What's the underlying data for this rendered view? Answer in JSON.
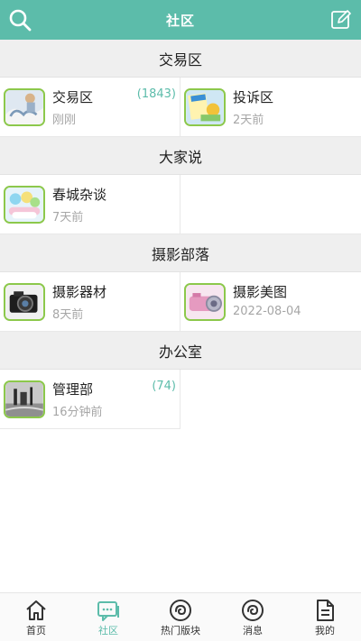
{
  "header": {
    "title": "社区"
  },
  "sections": [
    {
      "title": "交易区",
      "forums": [
        {
          "name": "交易区",
          "count": "(1843)",
          "time": "刚刚"
        },
        {
          "name": "投诉区",
          "count": "",
          "time": "2天前"
        }
      ]
    },
    {
      "title": "大家说",
      "forums": [
        {
          "name": "春城杂谈",
          "count": "",
          "time": "7天前"
        }
      ]
    },
    {
      "title": "摄影部落",
      "forums": [
        {
          "name": "摄影器材",
          "count": "",
          "time": "8天前"
        },
        {
          "name": "摄影美图",
          "count": "",
          "time": "2022-08-04"
        }
      ]
    },
    {
      "title": "办公室",
      "forums": [
        {
          "name": "管理部",
          "count": "(74)",
          "time": "16分钟前"
        }
      ]
    }
  ],
  "tabbar": [
    {
      "label": "首页",
      "icon": "home-icon"
    },
    {
      "label": "社区",
      "icon": "chat-icon",
      "active": true
    },
    {
      "label": "热门版块",
      "icon": "hot-icon"
    },
    {
      "label": "消息",
      "icon": "message-icon"
    },
    {
      "label": "我的",
      "icon": "document-icon"
    }
  ],
  "colors": {
    "accent": "#5cbcaa",
    "thumb_border": "#8cc84b"
  }
}
